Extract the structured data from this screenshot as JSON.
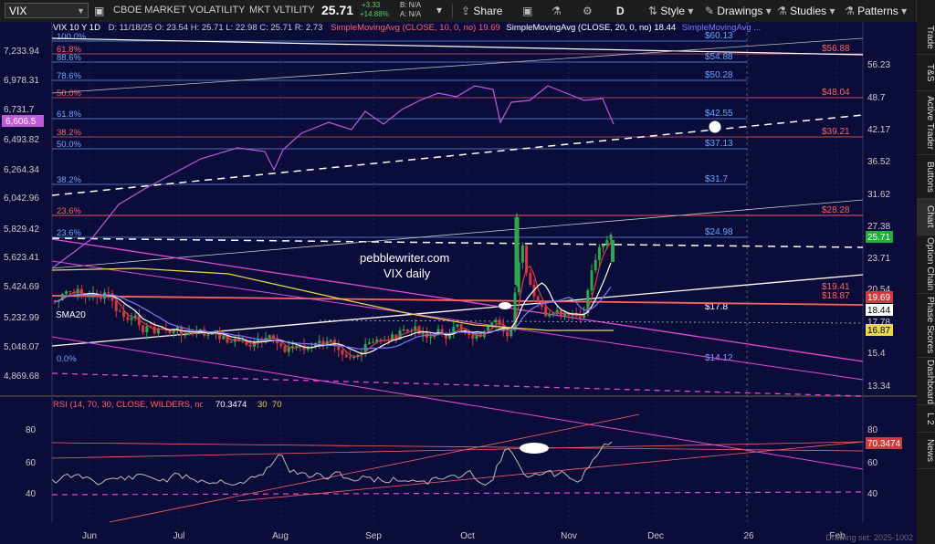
{
  "toolbar": {
    "symbol": "VIX",
    "company": "CBOE MARKET VOLATILITY",
    "short_name": "MKT VLTILITY",
    "last": "25.71",
    "change": "+3.33",
    "change_pct": "+14.88%",
    "bid_ask": "B: N/A",
    "ask": "A: N/A",
    "share_label": "Share",
    "period": "D",
    "style_label": "Style",
    "drawings_label": "Drawings",
    "studies_label": "Studies",
    "patterns_label": "Patterns"
  },
  "info": {
    "header": "VIX 10 Y 1D",
    "ohlc": "D: 11/18/25   O: 23.54   H: 25.71   L: 22.98   C: 25.71   R: 2.73",
    "sma10": "SimpleMovingAvg (CLOSE, 10, 0, no)",
    "sma10_val": "19.69",
    "sma20": "SimpleMovingAvg (CLOSE, 20, 0, no)",
    "sma20_val": "18.44",
    "sma_more": "SimpleMovingAvg ...",
    "sma20_tag": "SMA20",
    "watermark1": "pebblewriter.com",
    "watermark2": "VIX daily",
    "rsi_label": "RSI (14, 70, 30, CLOSE, WILDERS, no)",
    "rsi_val": "70.3474",
    "rsi_ob": "30",
    "rsi_os": "70",
    "footer_note": "Drawing set: 2025-1002"
  },
  "left_axis": [
    "7,233.94",
    "6,978.31",
    "6,731.7",
    "6,606.5",
    "6,493.82",
    "6,264.34",
    "6,042.96",
    "5,829.42",
    "5,623.41",
    "5,424.69",
    "5,232.99",
    "5,048.07",
    "4,869.68"
  ],
  "right_axis": [
    "56.23",
    "48.7",
    "42.17",
    "36.52",
    "31.62",
    "27.38",
    "23.71",
    "20.54",
    "17.78",
    "15.4",
    "13.34"
  ],
  "rsi_axis": [
    "80",
    "60",
    "40"
  ],
  "fib_levels": [
    {
      "pct": "100.0%",
      "val": "$60.13",
      "color": "#6aa9ff"
    },
    {
      "pct": "61.8%",
      "val": "$56.88",
      "color": "#ff6262"
    },
    {
      "pct": "88.6%",
      "val": "$54.88",
      "color": "#6aa9ff"
    },
    {
      "pct": "78.6%",
      "val": "$50.28",
      "color": "#6aa9ff"
    },
    {
      "pct": "50.0%",
      "val": "$48.04",
      "color": "#ff6262"
    },
    {
      "pct": "61.8%",
      "val": "$42.55",
      "color": "#6aa9ff"
    },
    {
      "pct": "38.2%",
      "val": "$39.21",
      "color": "#ff6262"
    },
    {
      "pct": "50.0%",
      "val": "$37.13",
      "color": "#6aa9ff"
    },
    {
      "pct": "38.2%",
      "val": "$31.7",
      "color": "#6aa9ff"
    },
    {
      "pct": "23.6%",
      "val": "$28.28",
      "color": "#ff6262"
    },
    {
      "pct": "23.6%",
      "val": "$24.98",
      "color": "#6aa9ff"
    },
    {
      "pct": "",
      "val": "$19.41",
      "color": "#ff6262"
    },
    {
      "pct": "",
      "val": "$18.87",
      "color": "#ff6262"
    },
    {
      "pct": "",
      "val": "$17.8",
      "color": "#ffffff"
    },
    {
      "pct": "0.0%",
      "val": "$14.12",
      "color": "#6aa9ff"
    }
  ],
  "price_tags": [
    {
      "label": "25.71",
      "bg": "#1fae3a",
      "fg": "#fff"
    },
    {
      "label": "19.69",
      "bg": "#d23b3b",
      "fg": "#fff"
    },
    {
      "label": "18.44",
      "bg": "#ffffff",
      "fg": "#000"
    },
    {
      "label": "16.87",
      "bg": "#e8d84a",
      "fg": "#000"
    },
    {
      "label": "70.3474",
      "bg": "#d23b3b",
      "fg": "#fff"
    }
  ],
  "spx_tag": "6,606.5",
  "months": [
    "Jun",
    "Jul",
    "Aug",
    "Sep",
    "Oct",
    "Nov",
    "Dec",
    "26",
    "Feb"
  ],
  "side_tabs": [
    "Trade",
    "T&S",
    "Active Trader",
    "Buttons",
    "Chart",
    "Option Chain",
    "Phase Scores",
    "Dashboard",
    "L 2",
    "News"
  ],
  "colors": {
    "candle_up": "#2ea84a",
    "candle_down": "#d23b3b",
    "spx_line": "#c05ad8",
    "fib_blue": "#6aa9ff",
    "fib_red": "#ff6262"
  }
}
